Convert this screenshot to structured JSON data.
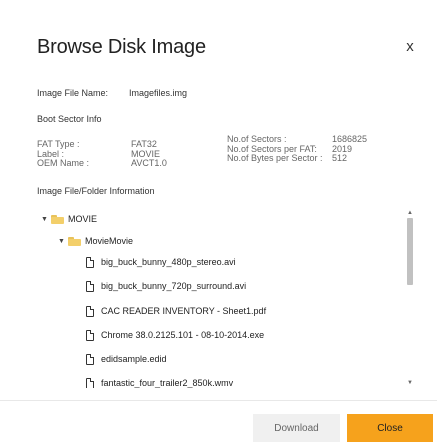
{
  "dialog": {
    "title": "Browse Disk Image",
    "close_glyph": "x"
  },
  "image_file": {
    "label": "Image File Name:",
    "value": "Imagefiles.img"
  },
  "boot_sector": {
    "heading": "Boot Sector Info",
    "fat_type_label": "FAT Type :",
    "fat_type_value": "FAT32",
    "label_label": "Label :",
    "label_value": "MOVIE",
    "oem_label": "OEM Name :",
    "oem_value": "AVCT1.0",
    "sectors_label": "No.of Sectors :",
    "sectors_value": "1686825",
    "sectors_per_fat_label": "No.of Sectors per FAT:",
    "sectors_per_fat_value": "2019",
    "bytes_per_sector_label": "No.of Bytes per Sector :",
    "bytes_per_sector_value": "512"
  },
  "folder_info": {
    "heading": "Image File/Folder Information"
  },
  "tree": {
    "root": {
      "name": "MOVIE",
      "expanded": true
    },
    "child": {
      "name": "MovieMovie",
      "expanded": true
    },
    "files": [
      "big_buck_bunny_480p_stereo.avi",
      "big_buck_bunny_720p_surround.avi",
      "CAC READER INVENTORY - Sheet1.pdf",
      "Chrome 38.0.2125.101 - 08-10-2014.exe",
      "edidsample.edid",
      "fantastic_four_trailer2_850k.wmv"
    ]
  },
  "buttons": {
    "download": "Download",
    "close": "Close"
  },
  "colors": {
    "accent": "#f6a21c",
    "folder": "#f3cf6a",
    "secondary_button": "#f0f0f0"
  }
}
